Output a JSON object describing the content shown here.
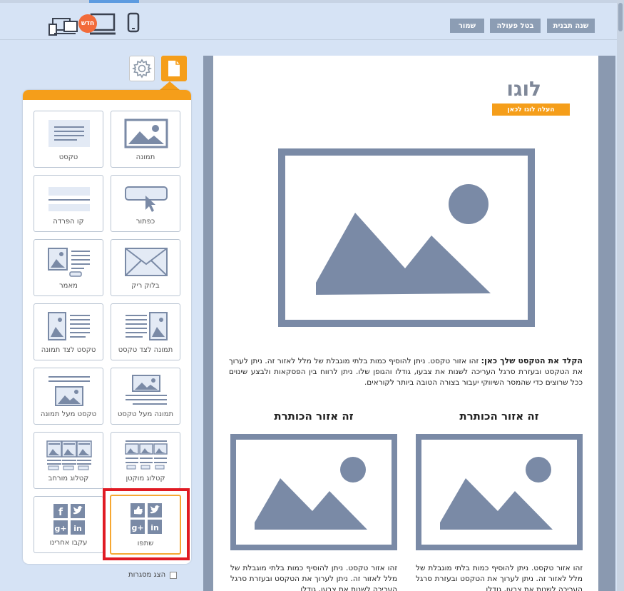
{
  "topbar": {
    "new_badge": "חדש",
    "save_label": "שמור",
    "undo_label": "בטל פעולה",
    "change_template_label": "שנה תבנית",
    "devices": [
      "all-devices-icon",
      "desktop-icon",
      "mobile-icon"
    ]
  },
  "sidebar": {
    "tabs": [
      "page-icon",
      "gear-icon"
    ],
    "blocks": [
      {
        "label": "תמונה",
        "icon": "image-block-icon"
      },
      {
        "label": "טקסט",
        "icon": "text-block-icon"
      },
      {
        "label": "כפתור",
        "icon": "button-block-icon"
      },
      {
        "label": "קו הפרדה",
        "icon": "divider-block-icon"
      },
      {
        "label": "בלוק ריק",
        "icon": "empty-block-icon"
      },
      {
        "label": "מאמר",
        "icon": "article-block-icon"
      },
      {
        "label": "תמונה לצד טקסט",
        "icon": "image-beside-text-icon"
      },
      {
        "label": "טקסט לצד תמונה",
        "icon": "text-beside-image-icon"
      },
      {
        "label": "תמונה מעל טקסט",
        "icon": "image-above-text-icon"
      },
      {
        "label": "טקסט מעל תמונה",
        "icon": "text-above-image-icon"
      },
      {
        "label": "קטלוג מוקטן",
        "icon": "small-catalog-icon"
      },
      {
        "label": "קטלוג מורחב",
        "icon": "wide-catalog-icon"
      },
      {
        "label": "שתפו",
        "icon": "share-block-icon"
      },
      {
        "label": "עקבו אחרינו",
        "icon": "follow-us-block-icon"
      }
    ],
    "show_frames_label": "הצג מסגרות",
    "show_frames_checked": false
  },
  "canvas": {
    "logo_text": "לוגו",
    "upload_logo_label": "העלה לוגו לכאן",
    "body_bold": "הקלד את הטקסט שלך כאן:",
    "body_text": " זהו אזור טקסט. ניתן להוסיף כמות בלתי מוגבלת של מלל לאזור זה. ניתן לערוך את הטקסט ובעזרת סרגל העריכה לשנות את צבעו, גודלו והגופן שלו. ניתן לרווח בין הפסקאות ולבצע שינוים ככל שרוצים כדי שהמסר השיווקי יעבור בצורה הטובה ביותר לקוראים.",
    "col_right_title": "זה אזור הכותרת",
    "col_left_title": "זה אזור הכותרת",
    "col_right_text": "זהו אזור טקסט. ניתן להוסיף כמות בלתי מוגבלת של מלל לאזור זה. ניתן לערוך את הטקסט ובעזרת סרגל העריכה לשנות את צבעו, גודלו",
    "col_left_text": "זהו אזור טקסט. ניתן להוסיף כמות בלתי מוגבלת של מלל לאזור זה. ניתן לערוך את הטקסט ובעזרת סרגל העריכה לשנות את צבעו, גודלו"
  },
  "colors": {
    "accent": "#f59e1a",
    "placeholder": "#7a8aa6",
    "toolbar_button": "#8c9db4",
    "highlight": "#e01b24"
  }
}
